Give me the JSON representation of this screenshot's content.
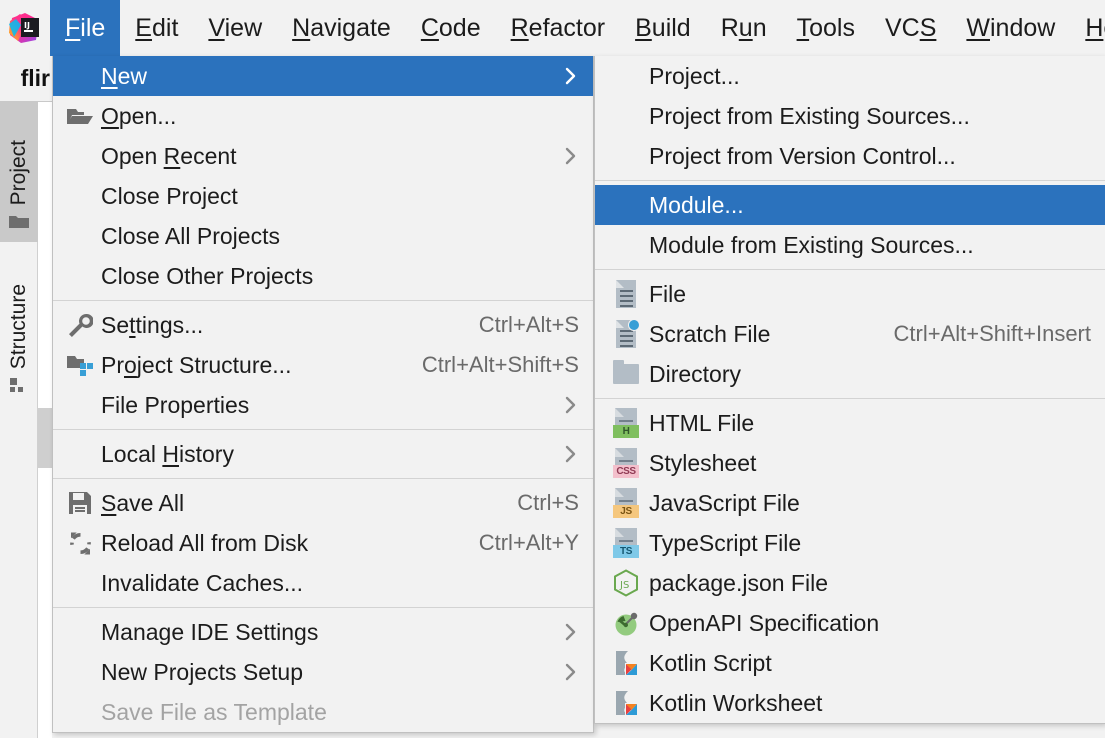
{
  "app": {
    "logo_name": "intellij-idea-logo"
  },
  "menubar": {
    "items": [
      {
        "label": "File",
        "mnemonic": "F",
        "active": true
      },
      {
        "label": "Edit",
        "mnemonic": "E",
        "active": false
      },
      {
        "label": "View",
        "mnemonic": "V",
        "active": false
      },
      {
        "label": "Navigate",
        "mnemonic": "N",
        "active": false
      },
      {
        "label": "Code",
        "mnemonic": "C",
        "active": false
      },
      {
        "label": "Refactor",
        "mnemonic": "R",
        "active": false
      },
      {
        "label": "Build",
        "mnemonic": "B",
        "active": false
      },
      {
        "label": "Run",
        "mnemonic": "u",
        "active": false
      },
      {
        "label": "Tools",
        "mnemonic": "T",
        "active": false
      },
      {
        "label": "VCS",
        "mnemonic": "S",
        "active": false
      },
      {
        "label": "Window",
        "mnemonic": "W",
        "active": false
      },
      {
        "label": "Help",
        "mnemonic": "H",
        "active": false
      }
    ]
  },
  "ide": {
    "project_tab_label": "flir",
    "tool_buttons": [
      {
        "label": "Project",
        "icon": "folder-icon",
        "active": true
      },
      {
        "label": "Structure",
        "icon": "structure-icon",
        "active": false
      }
    ]
  },
  "file_menu": {
    "name": "File",
    "groups": [
      {
        "items": [
          {
            "label": "New",
            "mnemonic": "N",
            "icon": "",
            "shortcut": "",
            "submenu": true,
            "selected": true,
            "disabled": false
          },
          {
            "label": "Open...",
            "mnemonic": "O",
            "icon": "open-folder-icon",
            "shortcut": "",
            "submenu": false,
            "selected": false,
            "disabled": false
          },
          {
            "label": "Open Recent",
            "mnemonic": "R",
            "icon": "",
            "shortcut": "",
            "submenu": true,
            "selected": false,
            "disabled": false
          },
          {
            "label": "Close Project",
            "mnemonic": "",
            "icon": "",
            "shortcut": "",
            "submenu": false,
            "selected": false,
            "disabled": false
          },
          {
            "label": "Close All Projects",
            "mnemonic": "",
            "icon": "",
            "shortcut": "",
            "submenu": false,
            "selected": false,
            "disabled": false
          },
          {
            "label": "Close Other Projects",
            "mnemonic": "",
            "icon": "",
            "shortcut": "",
            "submenu": false,
            "selected": false,
            "disabled": false
          }
        ]
      },
      {
        "items": [
          {
            "label": "Settings...",
            "mnemonic": "t",
            "icon": "wrench-icon",
            "shortcut": "Ctrl+Alt+S",
            "submenu": false,
            "selected": false,
            "disabled": false
          },
          {
            "label": "Project Structure...",
            "mnemonic": "o",
            "icon": "project-structure-icon",
            "shortcut": "Ctrl+Alt+Shift+S",
            "submenu": false,
            "selected": false,
            "disabled": false
          },
          {
            "label": "File Properties",
            "mnemonic": "",
            "icon": "",
            "shortcut": "",
            "submenu": true,
            "selected": false,
            "disabled": false
          }
        ]
      },
      {
        "items": [
          {
            "label": "Local History",
            "mnemonic": "H",
            "icon": "",
            "shortcut": "",
            "submenu": true,
            "selected": false,
            "disabled": false
          }
        ]
      },
      {
        "items": [
          {
            "label": "Save All",
            "mnemonic": "S",
            "icon": "save-icon",
            "shortcut": "Ctrl+S",
            "submenu": false,
            "selected": false,
            "disabled": false
          },
          {
            "label": "Reload All from Disk",
            "mnemonic": "",
            "icon": "reload-icon",
            "shortcut": "Ctrl+Alt+Y",
            "submenu": false,
            "selected": false,
            "disabled": false
          },
          {
            "label": "Invalidate Caches...",
            "mnemonic": "",
            "icon": "",
            "shortcut": "",
            "submenu": false,
            "selected": false,
            "disabled": false
          }
        ]
      },
      {
        "items": [
          {
            "label": "Manage IDE Settings",
            "mnemonic": "",
            "icon": "",
            "shortcut": "",
            "submenu": true,
            "selected": false,
            "disabled": false
          },
          {
            "label": "New Projects Setup",
            "mnemonic": "",
            "icon": "",
            "shortcut": "",
            "submenu": true,
            "selected": false,
            "disabled": false
          },
          {
            "label": "Save File as Template",
            "mnemonic": "",
            "icon": "",
            "shortcut": "",
            "submenu": false,
            "selected": false,
            "disabled": true
          }
        ]
      }
    ]
  },
  "new_submenu": {
    "name": "New",
    "groups": [
      {
        "items": [
          {
            "label": "Project...",
            "icon": "",
            "shortcut": "",
            "selected": false
          },
          {
            "label": "Project from Existing Sources...",
            "icon": "",
            "shortcut": "",
            "selected": false
          },
          {
            "label": "Project from Version Control...",
            "icon": "",
            "shortcut": "",
            "selected": false
          }
        ]
      },
      {
        "items": [
          {
            "label": "Module...",
            "icon": "",
            "shortcut": "",
            "selected": true
          },
          {
            "label": "Module from Existing Sources...",
            "icon": "",
            "shortcut": "",
            "selected": false
          }
        ]
      },
      {
        "items": [
          {
            "label": "File",
            "icon": "file-icon",
            "shortcut": "",
            "selected": false
          },
          {
            "label": "Scratch File",
            "icon": "scratch-file-icon",
            "shortcut": "Ctrl+Alt+Shift+Insert",
            "selected": false
          },
          {
            "label": "Directory",
            "icon": "directory-icon",
            "shortcut": "",
            "selected": false
          }
        ]
      },
      {
        "items": [
          {
            "label": "HTML File",
            "icon": "html-file-icon",
            "badge": "H",
            "badge_bg": "#7fbf5f",
            "badge_fg": "#30562a",
            "shortcut": "",
            "selected": false
          },
          {
            "label": "Stylesheet",
            "icon": "css-file-icon",
            "badge": "CSS",
            "badge_bg": "#f3c0cc",
            "badge_fg": "#8f3a54",
            "shortcut": "",
            "selected": false
          },
          {
            "label": "JavaScript File",
            "icon": "js-file-icon",
            "badge": "JS",
            "badge_bg": "#f5c77e",
            "badge_fg": "#7a5413",
            "shortcut": "",
            "selected": false
          },
          {
            "label": "TypeScript File",
            "icon": "ts-file-icon",
            "badge": "TS",
            "badge_bg": "#7fc9e8",
            "badge_fg": "#14566f",
            "shortcut": "",
            "selected": false
          },
          {
            "label": "package.json File",
            "icon": "nodejs-icon",
            "shortcut": "",
            "selected": false
          },
          {
            "label": "OpenAPI Specification",
            "icon": "openapi-icon",
            "shortcut": "",
            "selected": false
          },
          {
            "label": "Kotlin Script",
            "icon": "kotlin-script-icon",
            "shortcut": "",
            "selected": false
          },
          {
            "label": "Kotlin Worksheet",
            "icon": "kotlin-worksheet-icon",
            "shortcut": "",
            "selected": false
          }
        ]
      }
    ]
  },
  "colors": {
    "selection_blue": "#2B72BD",
    "menu_bg": "#f2f2f2",
    "text": "#1c1c1c",
    "shortcut_text": "#6a6a6a",
    "disabled_text": "#a3a3a3",
    "separator": "#d3d3d3"
  }
}
